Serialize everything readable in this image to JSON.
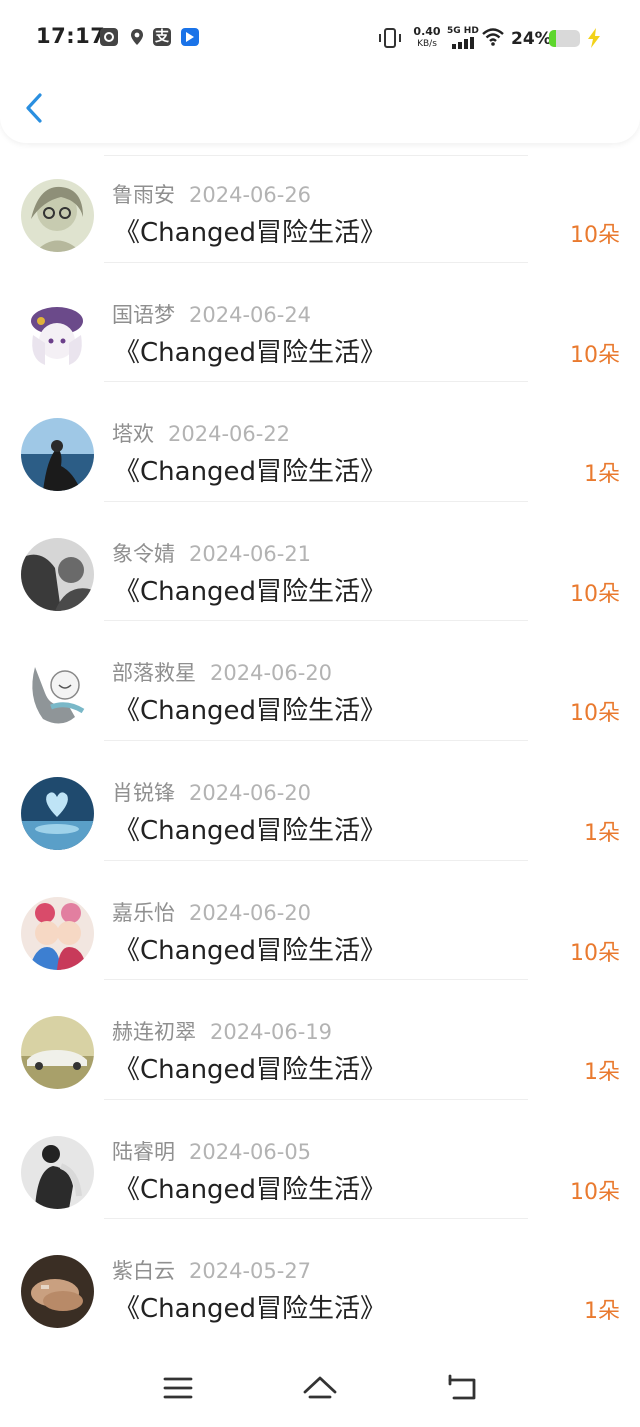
{
  "status_bar": {
    "time": "17:17",
    "net_speed": "0.40",
    "net_unit": "KB/s",
    "network_type": "5G HD",
    "battery_percent": "24%",
    "battery_level": 0.24,
    "notification_icons": [
      "chat-app-icon",
      "location-icon",
      "alipay-icon",
      "play-store-icon"
    ],
    "alipay_glyph": "支"
  },
  "header": {
    "back_icon": "chevron-left-icon",
    "accent_color": "#2a8fe0"
  },
  "gift_list": {
    "items": [
      {
        "name": "鲁雨安",
        "date": "2024-06-26",
        "book": "《Changed冒险生活》",
        "flowers": "10朵"
      },
      {
        "name": "国语梦",
        "date": "2024-06-24",
        "book": "《Changed冒险生活》",
        "flowers": "10朵"
      },
      {
        "name": "塔欢",
        "date": "2024-06-22",
        "book": "《Changed冒险生活》",
        "flowers": "1朵"
      },
      {
        "name": "象令婧",
        "date": "2024-06-21",
        "book": "《Changed冒险生活》",
        "flowers": "10朵"
      },
      {
        "name": "部落救星",
        "date": "2024-06-20",
        "book": "《Changed冒险生活》",
        "flowers": "10朵"
      },
      {
        "name": "肖锐锋",
        "date": "2024-06-20",
        "book": "《Changed冒险生活》",
        "flowers": "1朵"
      },
      {
        "name": "嘉乐怡",
        "date": "2024-06-20",
        "book": "《Changed冒险生活》",
        "flowers": "10朵"
      },
      {
        "name": "赫连初翠",
        "date": "2024-06-19",
        "book": "《Changed冒险生活》",
        "flowers": "1朵"
      },
      {
        "name": "陆睿明",
        "date": "2024-06-05",
        "book": "《Changed冒险生活》",
        "flowers": "10朵"
      },
      {
        "name": "紫白云",
        "date": "2024-05-27",
        "book": "《Changed冒险生活》",
        "flowers": "1朵"
      }
    ],
    "flower_color": "#e97a2f"
  },
  "bottom_nav": {
    "menu_icon": "menu-icon",
    "home_icon": "home-icon",
    "back_icon": "back-icon"
  }
}
